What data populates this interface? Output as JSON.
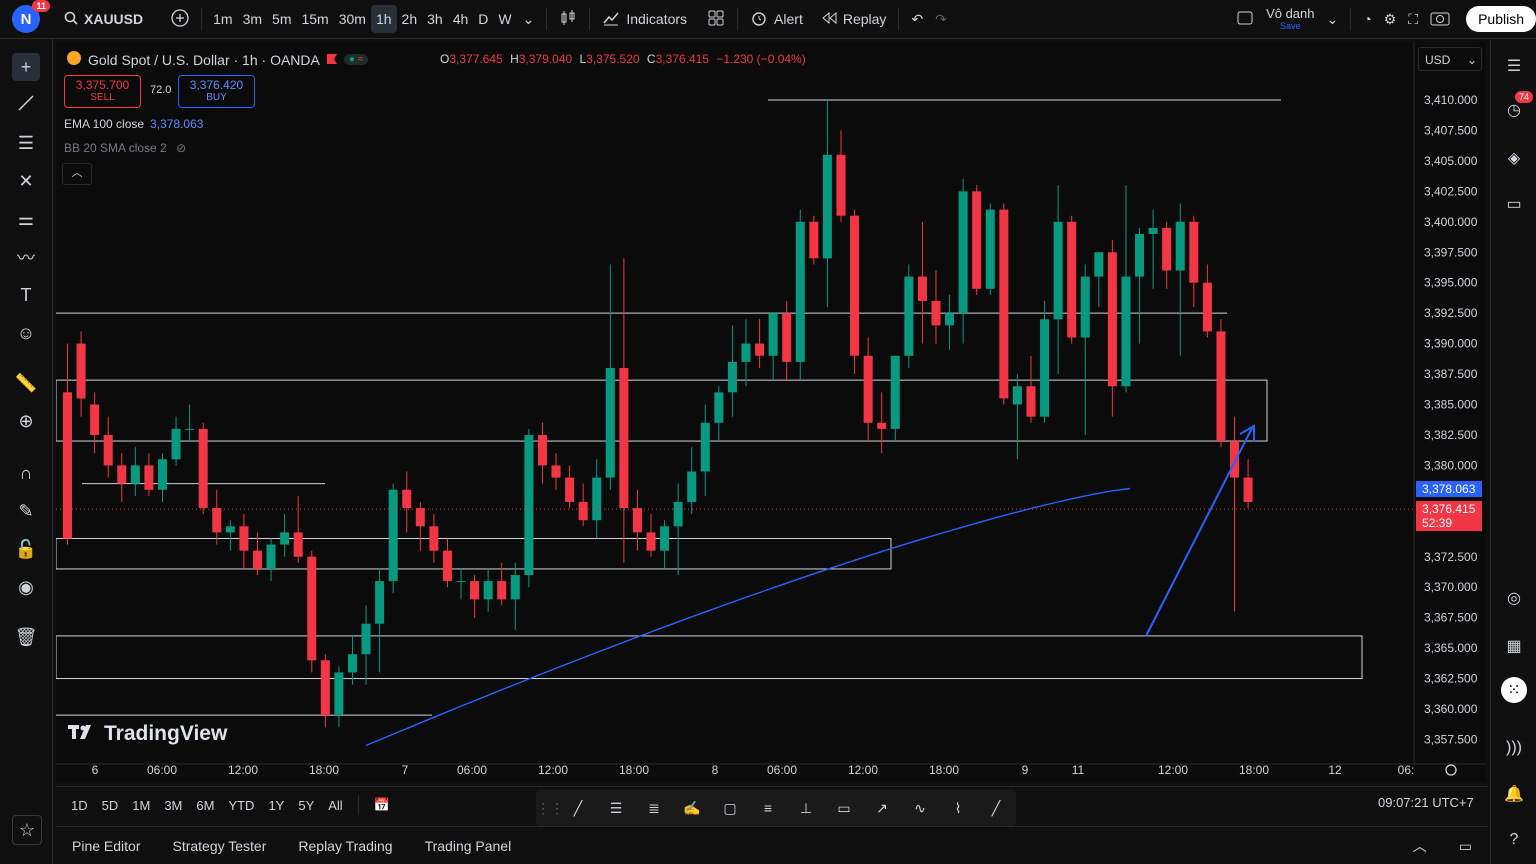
{
  "header": {
    "avatar_letter": "N",
    "avatar_badge": "11",
    "symbol": "XAUUSD",
    "intervals": [
      "1m",
      "3m",
      "5m",
      "15m",
      "30m",
      "1h",
      "2h",
      "3h",
      "4h",
      "D",
      "W"
    ],
    "active_interval": "1h",
    "indicators_label": "Indicators",
    "alert_label": "Alert",
    "replay_label": "Replay",
    "layout_name": "Vô danh",
    "layout_save": "Save",
    "publish_label": "Publish"
  },
  "legend": {
    "title": "Gold Spot / U.S. Dollar · 1h · OANDA",
    "o_label": "O",
    "o_val": "3,377.645",
    "h_label": "H",
    "h_val": "3,379.040",
    "l_label": "L",
    "l_val": "3,375.520",
    "c_label": "C",
    "c_val": "3,376.415",
    "change": "−1.230 (−0.04%)",
    "sell_price": "3,375.700",
    "sell_label": "SELL",
    "spread": "72.0",
    "buy_price": "3,376.420",
    "buy_label": "BUY",
    "ema_label": "EMA 100 close",
    "ema_value": "3,378.063",
    "bb_label": "BB 20 SMA close 2"
  },
  "currency": "USD",
  "price_labels": [
    "3,410.000",
    "3,407.500",
    "3,405.000",
    "3,402.500",
    "3,400.000",
    "3,397.500",
    "3,395.000",
    "3,392.500",
    "3,390.000",
    "3,387.500",
    "3,385.000",
    "3,382.500",
    "3,380.000",
    "3,372.500",
    "3,370.000",
    "3,367.500",
    "3,365.000",
    "3,362.500",
    "3,360.000",
    "3,357.500"
  ],
  "ema_tag": "3,378.063",
  "last_price_tag": "3,376.415",
  "countdown": "52:39",
  "time_labels": [
    "6",
    "06:00",
    "12:00",
    "18:00",
    "7",
    "06:00",
    "12:00",
    "18:00",
    "8",
    "06:00",
    "12:00",
    "18:00",
    "9",
    "11",
    "12:00",
    "18:00",
    "12",
    "06:"
  ],
  "brand": "TradingView",
  "timeframes": [
    "1D",
    "5D",
    "1M",
    "3M",
    "6M",
    "YTD",
    "1Y",
    "5Y",
    "All"
  ],
  "clock": "09:07:21 UTC+7",
  "bottom_tabs": [
    "Pine Editor",
    "Strategy Tester",
    "Replay Trading",
    "Trading Panel"
  ],
  "right_badge": "74",
  "colors": {
    "up": "#089981",
    "down": "#f23645",
    "ema": "#2962ff",
    "accent": "#2962ff"
  },
  "chart_data": {
    "type": "candlestick",
    "title": "Gold Spot / U.S. Dollar · 1h · OANDA",
    "ylim": [
      3356,
      3412
    ],
    "candles": [
      [
        3386.0,
        3390.0,
        3373.5,
        3374.0
      ],
      [
        3390.0,
        3391.0,
        3384.0,
        3385.5
      ],
      [
        3385.0,
        3386.0,
        3381.0,
        3382.5
      ],
      [
        3382.5,
        3384.0,
        3379.0,
        3380.0
      ],
      [
        3380.0,
        3381.0,
        3377.0,
        3378.5
      ],
      [
        3378.5,
        3381.5,
        3377.5,
        3380.0
      ],
      [
        3380.0,
        3381.0,
        3377.5,
        3378.0
      ],
      [
        3378.0,
        3381.0,
        3377.0,
        3380.5
      ],
      [
        3380.5,
        3384.0,
        3380.0,
        3383.0
      ],
      [
        3383.0,
        3385.0,
        3382.0,
        3383.0
      ],
      [
        3383.0,
        3383.5,
        3376.0,
        3376.5
      ],
      [
        3376.5,
        3378.0,
        3373.5,
        3374.5
      ],
      [
        3374.5,
        3375.5,
        3373.0,
        3375.0
      ],
      [
        3375.0,
        3376.0,
        3371.5,
        3373.0
      ],
      [
        3373.0,
        3374.5,
        3371.0,
        3371.5
      ],
      [
        3371.5,
        3374.0,
        3370.5,
        3373.5
      ],
      [
        3373.5,
        3376.0,
        3372.5,
        3374.5
      ],
      [
        3374.5,
        3377.5,
        3372.0,
        3372.5
      ],
      [
        3372.5,
        3373.0,
        3363.0,
        3364.0
      ],
      [
        3364.0,
        3364.5,
        3358.5,
        3359.5
      ],
      [
        3359.5,
        3363.5,
        3358.5,
        3363.0
      ],
      [
        3363.0,
        3366.0,
        3362.0,
        3364.5
      ],
      [
        3364.5,
        3368.5,
        3362.0,
        3367.0
      ],
      [
        3367.0,
        3371.5,
        3363.0,
        3370.5
      ],
      [
        3370.5,
        3378.5,
        3369.5,
        3378.0
      ],
      [
        3378.0,
        3379.5,
        3374.5,
        3376.5
      ],
      [
        3376.5,
        3377.0,
        3373.0,
        3375.0
      ],
      [
        3375.0,
        3376.0,
        3372.0,
        3373.0
      ],
      [
        3373.0,
        3374.0,
        3370.0,
        3370.5
      ],
      [
        3370.5,
        3371.5,
        3369.0,
        3370.5
      ],
      [
        3370.5,
        3371.0,
        3367.5,
        3369.0
      ],
      [
        3369.0,
        3371.5,
        3368.0,
        3370.5
      ],
      [
        3370.5,
        3372.0,
        3368.5,
        3369.0
      ],
      [
        3369.0,
        3372.0,
        3366.5,
        3371.0
      ],
      [
        3371.0,
        3383.0,
        3370.0,
        3382.5
      ],
      [
        3382.5,
        3383.5,
        3378.5,
        3380.0
      ],
      [
        3380.0,
        3381.0,
        3378.0,
        3379.0
      ],
      [
        3379.0,
        3380.0,
        3376.5,
        3377.0
      ],
      [
        3377.0,
        3378.5,
        3375.0,
        3375.5
      ],
      [
        3375.5,
        3380.5,
        3374.0,
        3379.0
      ],
      [
        3379.0,
        3396.5,
        3378.0,
        3388.0
      ],
      [
        3388.0,
        3397.0,
        3372.0,
        3376.5
      ],
      [
        3376.5,
        3378.0,
        3373.0,
        3374.5
      ],
      [
        3374.5,
        3376.0,
        3372.5,
        3373.0
      ],
      [
        3373.0,
        3375.5,
        3371.5,
        3375.0
      ],
      [
        3375.0,
        3378.5,
        3371.0,
        3377.0
      ],
      [
        3377.0,
        3381.5,
        3376.0,
        3379.5
      ],
      [
        3379.5,
        3385.0,
        3377.5,
        3383.5
      ],
      [
        3383.5,
        3386.5,
        3382.0,
        3386.0
      ],
      [
        3386.0,
        3391.5,
        3384.0,
        3388.5
      ],
      [
        3388.5,
        3392.0,
        3386.5,
        3390.0
      ],
      [
        3390.0,
        3392.0,
        3388.0,
        3389.0
      ],
      [
        3389.0,
        3392.5,
        3387.0,
        3392.5
      ],
      [
        3392.5,
        3393.5,
        3387.0,
        3388.5
      ],
      [
        3388.5,
        3401.0,
        3387.0,
        3400.0
      ],
      [
        3400.0,
        3400.5,
        3396.5,
        3397.0
      ],
      [
        3397.0,
        3410.0,
        3393.0,
        3405.5
      ],
      [
        3405.5,
        3407.5,
        3400.0,
        3400.5
      ],
      [
        3400.5,
        3401.0,
        3387.5,
        3389.0
      ],
      [
        3389.0,
        3390.5,
        3382.0,
        3383.5
      ],
      [
        3383.5,
        3386.0,
        3381.0,
        3383.0
      ],
      [
        3383.0,
        3388.0,
        3382.0,
        3389.0
      ],
      [
        3389.0,
        3396.5,
        3388.0,
        3395.5
      ],
      [
        3395.5,
        3400.0,
        3390.0,
        3393.5
      ],
      [
        3393.5,
        3396.0,
        3390.0,
        3391.5
      ],
      [
        3391.5,
        3394.0,
        3389.5,
        3392.5
      ],
      [
        3392.5,
        3403.5,
        3390.0,
        3402.5
      ],
      [
        3402.5,
        3403.0,
        3394.0,
        3394.5
      ],
      [
        3394.5,
        3401.5,
        3394.0,
        3401.0
      ],
      [
        3401.0,
        3401.5,
        3385.0,
        3385.5
      ],
      [
        3385.0,
        3387.5,
        3380.5,
        3386.5
      ],
      [
        3386.5,
        3389.0,
        3383.5,
        3384.0
      ],
      [
        3384.0,
        3393.5,
        3383.5,
        3392.0
      ],
      [
        3392.0,
        3403.0,
        3387.5,
        3400.0
      ],
      [
        3400.0,
        3400.5,
        3390.0,
        3390.5
      ],
      [
        3390.5,
        3396.5,
        3382.5,
        3395.5
      ],
      [
        3395.5,
        3397.5,
        3393.0,
        3397.5
      ],
      [
        3397.5,
        3398.5,
        3384.0,
        3386.5
      ],
      [
        3386.5,
        3403.0,
        3386.0,
        3395.5
      ],
      [
        3395.5,
        3399.5,
        3390.0,
        3399.0
      ],
      [
        3399.0,
        3401.0,
        3394.5,
        3399.5
      ],
      [
        3399.5,
        3400.0,
        3394.5,
        3396.0
      ],
      [
        3396.0,
        3401.5,
        3389.0,
        3400.0
      ],
      [
        3400.0,
        3400.5,
        3393.0,
        3395.0
      ],
      [
        3395.0,
        3396.5,
        3390.5,
        3391.0
      ],
      [
        3391.0,
        3392.0,
        3381.5,
        3382.0
      ],
      [
        3382.0,
        3384.0,
        3368.0,
        3379.0
      ],
      [
        3379.0,
        3380.5,
        3376.5,
        3377.0
      ]
    ],
    "ema_100": {
      "first": 3357.0,
      "last": 3378.1
    },
    "rectangles": [
      {
        "top": 3387.0,
        "bottom": 3382.0
      },
      {
        "top": 3374.0,
        "bottom": 3371.5
      },
      {
        "top": 3366.0,
        "bottom": 3362.5
      }
    ],
    "horizontal_lines": [
      3410.0,
      3392.5,
      3378.5,
      3359.5
    ]
  }
}
